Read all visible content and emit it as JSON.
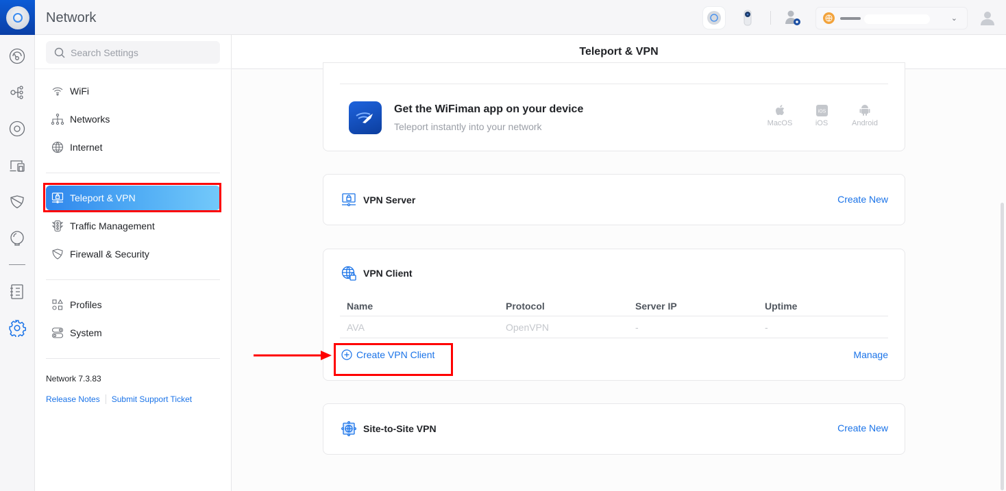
{
  "app": {
    "title": "Network",
    "page_title": "Teleport & VPN"
  },
  "rail": {
    "items": [
      {
        "name": "dashboard",
        "icon": "dashboard-icon"
      },
      {
        "name": "topology",
        "icon": "topology-icon"
      },
      {
        "name": "unifi-devices",
        "icon": "devices-icon"
      },
      {
        "name": "client-devices",
        "icon": "clients-icon"
      },
      {
        "name": "insights",
        "icon": "shield-icon"
      },
      {
        "name": "alerts",
        "icon": "bulb-icon"
      },
      {
        "name": "system-log",
        "icon": "notebook-icon"
      },
      {
        "name": "settings",
        "icon": "gear-icon",
        "active": true
      }
    ]
  },
  "topbar": {
    "site_selector_chevron": "⌄"
  },
  "search": {
    "placeholder": "Search Settings",
    "value": ""
  },
  "sidebar": {
    "groups": [
      [
        {
          "label": "WiFi",
          "icon": "wifi-icon"
        },
        {
          "label": "Networks",
          "icon": "networks-icon"
        },
        {
          "label": "Internet",
          "icon": "globe-icon"
        }
      ],
      [
        {
          "label": "Teleport & VPN",
          "icon": "vpn-monitor-icon",
          "active": true
        },
        {
          "label": "Traffic Management",
          "icon": "traffic-light-icon"
        },
        {
          "label": "Firewall & Security",
          "icon": "shield-icon"
        }
      ],
      [
        {
          "label": "Profiles",
          "icon": "shapes-icon"
        },
        {
          "label": "System",
          "icon": "toggles-icon"
        }
      ]
    ],
    "version": "Network 7.3.83",
    "links": {
      "release_notes": "Release Notes",
      "support_ticket": "Submit Support Ticket"
    }
  },
  "wifiman": {
    "title": "Get the WiFiman app on your device",
    "subtitle": "Teleport instantly into your network",
    "platforms": [
      {
        "label": "MacOS",
        "icon": "apple-icon"
      },
      {
        "label": "iOS",
        "icon": "ios-icon"
      },
      {
        "label": "Android",
        "icon": "android-icon"
      }
    ]
  },
  "vpn_server": {
    "title": "VPN Server",
    "action": "Create New"
  },
  "vpn_client": {
    "title": "VPN Client",
    "columns": [
      "Name",
      "Protocol",
      "Server IP",
      "Uptime"
    ],
    "rows": [
      [
        "AVA",
        "OpenVPN",
        "-",
        "-"
      ]
    ],
    "create_label": "Create VPN Client",
    "manage_label": "Manage"
  },
  "site_to_site": {
    "title": "Site-to-Site VPN",
    "action": "Create New"
  },
  "colors": {
    "accent": "#1a73e8",
    "annotation": "#ff0000",
    "active_gradient_start": "#2f86ec",
    "active_gradient_end": "#73c9fa"
  }
}
